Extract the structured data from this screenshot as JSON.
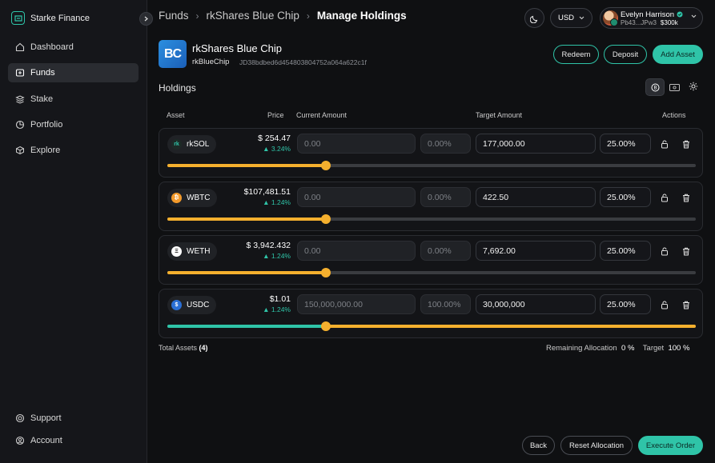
{
  "app": {
    "name": "Starke Finance"
  },
  "sidebar": {
    "items": [
      {
        "label": "Dashboard",
        "icon": "home-icon"
      },
      {
        "label": "Funds",
        "icon": "funds-icon",
        "active": true
      },
      {
        "label": "Stake",
        "icon": "stake-icon"
      },
      {
        "label": "Portfolio",
        "icon": "portfolio-icon"
      },
      {
        "label": "Explore",
        "icon": "explore-icon"
      }
    ],
    "footer": [
      {
        "label": "Support",
        "icon": "support-icon"
      },
      {
        "label": "Account",
        "icon": "account-icon"
      }
    ]
  },
  "breadcrumb": {
    "items": [
      "Funds",
      "rkShares Blue Chip"
    ],
    "current": "Manage Holdings"
  },
  "header": {
    "currency": "USD"
  },
  "user": {
    "name": "Evelyn Harrison",
    "address": "Pb43...JPw3",
    "balance": "$300k"
  },
  "fund": {
    "logo_text": "BC",
    "name": "rkShares Blue Chip",
    "symbol": "rkBlueChip",
    "address": "JD38bdbed6d454803804752a064a622c1f"
  },
  "actions": {
    "redeem": "Redeem",
    "deposit": "Deposit",
    "add_asset": "Add Asset"
  },
  "holdings": {
    "title": "Holdings",
    "columns": {
      "asset": "Asset",
      "price": "Price",
      "current": "Current Amount",
      "target": "Target Amount",
      "actions": "Actions"
    },
    "rows": [
      {
        "asset": "rkSOL",
        "price": "$ 254.47",
        "change": "▲ 3.24%",
        "current_amount": "0.00",
        "current_pct": "0.00%",
        "target_amount": "177,000.00",
        "target_pct": "25.00%",
        "current_level": 0,
        "target_level": 0.3
      },
      {
        "asset": "WBTC",
        "price": "$107,481.51",
        "change": "▲ 1.24%",
        "current_amount": "0.00",
        "current_pct": "0.00%",
        "target_amount": "422.50",
        "target_pct": "25.00%",
        "current_level": 0,
        "target_level": 0.3
      },
      {
        "asset": "WETH",
        "price": "$ 3,942.432",
        "change": "▲ 1.24%",
        "current_amount": "0.00",
        "current_pct": "0.00%",
        "target_amount": "7,692.00",
        "target_pct": "25.00%",
        "current_level": 0,
        "target_level": 0.3
      },
      {
        "asset": "USDC",
        "price": "$1.01",
        "change": "▲ 1.24%",
        "current_amount": "150,000,000.00",
        "current_pct": "100.00%",
        "target_amount": "30,000,000",
        "target_pct": "25.00%",
        "current_level": 1,
        "target_level": 0.3
      }
    ],
    "total_label": "Total Assets",
    "total_count": "(4)",
    "remaining_label": "Remaining Allocation",
    "remaining_value": "0 %",
    "target_label": "Target",
    "target_value": "100 %"
  },
  "footer_buttons": {
    "back": "Back",
    "reset": "Reset Allocation",
    "execute": "Execute Order"
  },
  "colors": {
    "accent": "#2fc4a8",
    "slider": "#f5b02e"
  }
}
